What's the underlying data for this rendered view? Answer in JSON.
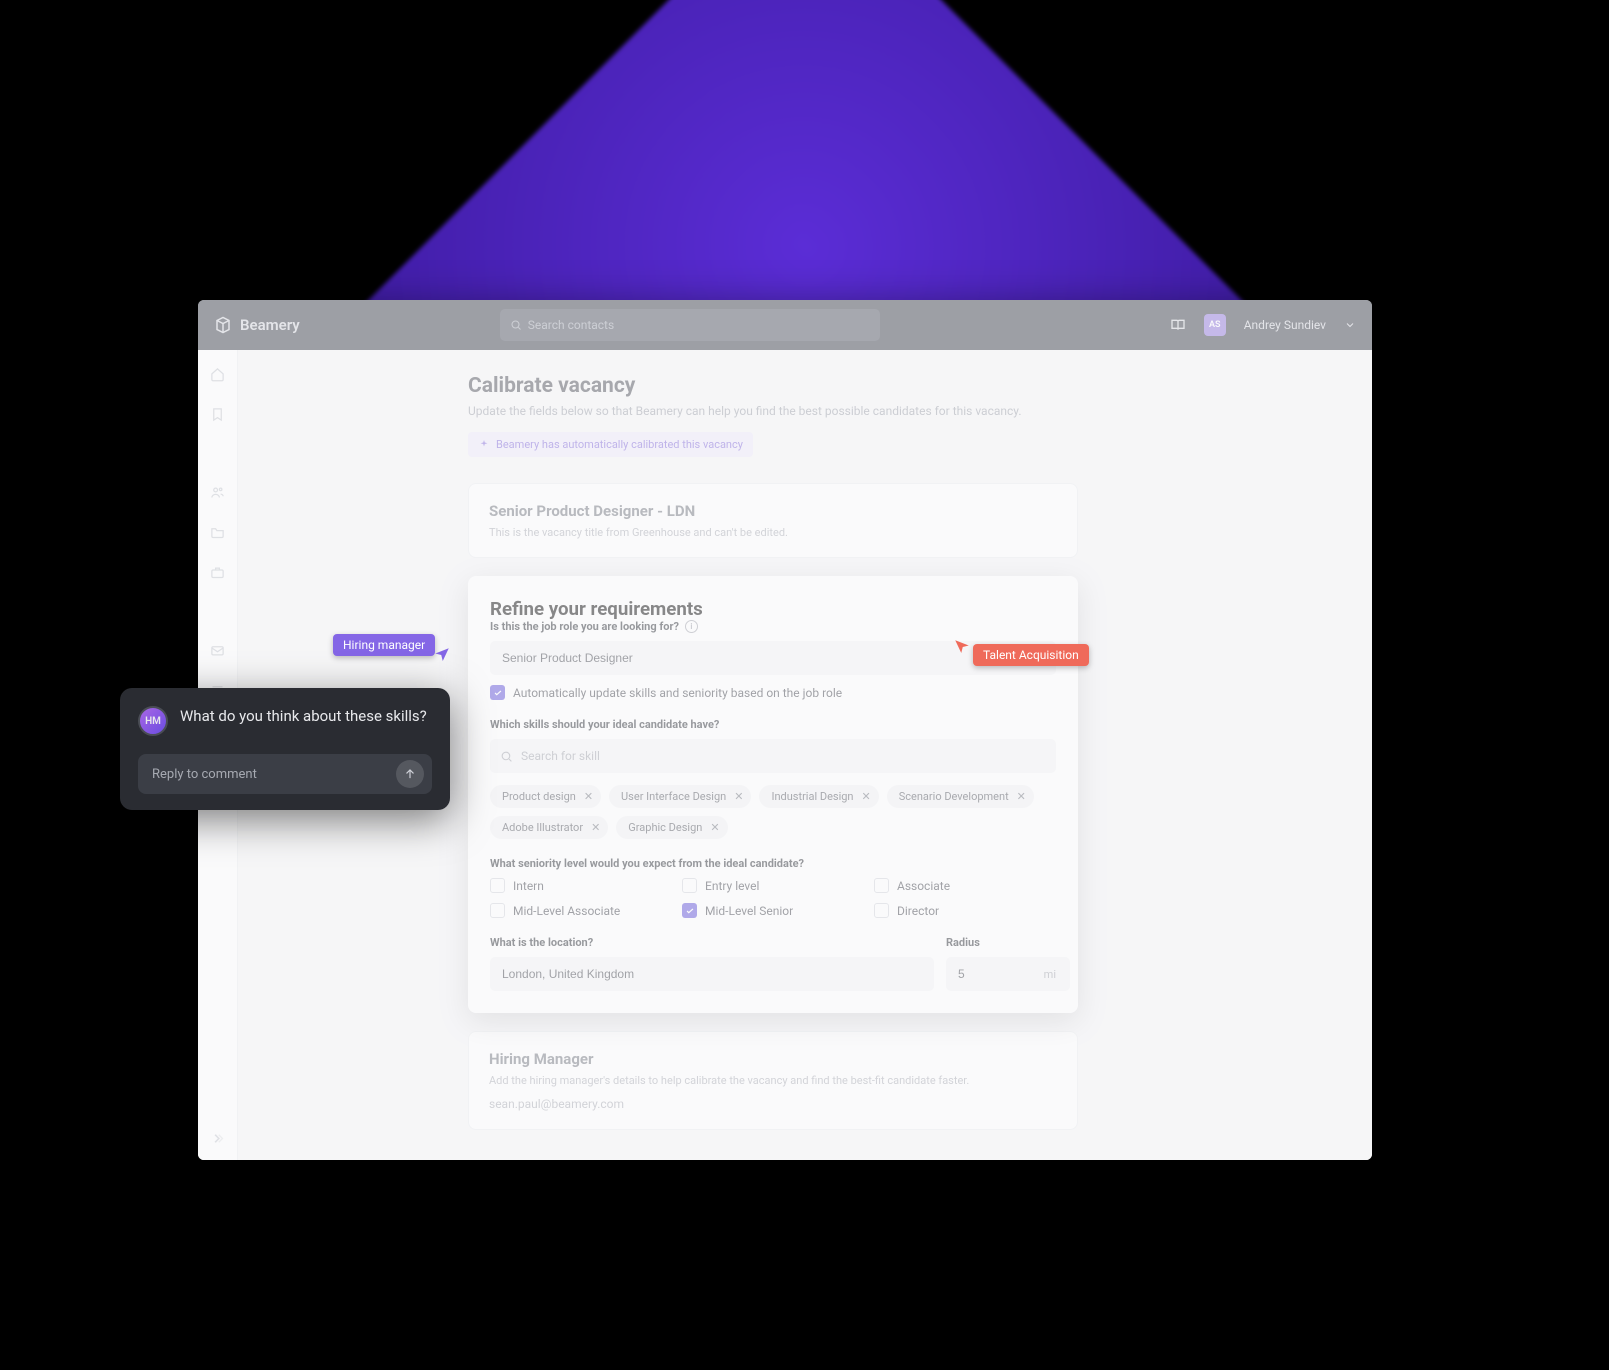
{
  "brand": {
    "name": "Beamery"
  },
  "search": {
    "placeholder": "Search contacts"
  },
  "user": {
    "initials": "AS",
    "name": "Andrey Sundiev"
  },
  "page": {
    "title": "Calibrate vacancy",
    "subtitle": "Update the fields below so that Beamery can help you find the best possible candidates for this vacancy.",
    "auto_badge": "Beamery has automatically calibrated this vacancy"
  },
  "title_block": {
    "heading": "Senior Product Designer - LDN",
    "sub": "This is the vacancy title from Greenhouse and can't be edited."
  },
  "refine": {
    "heading": "Refine your requirements",
    "role_label": "Is this the job role you are looking for?",
    "role_value": "Senior Product Designer",
    "auto_update_label": "Automatically update skills and seniority based on the job role",
    "auto_update_checked": true,
    "skills_label": "Which skills should your ideal candidate have?",
    "skills_placeholder": "Search for skill",
    "skills": [
      "Product design",
      "User Interface Design",
      "Industrial Design",
      "Scenario Development",
      "Adobe Illustrator",
      "Graphic Design"
    ],
    "seniority_label": "What seniority level would you expect from the ideal candidate?",
    "seniority": [
      {
        "label": "Intern",
        "checked": false
      },
      {
        "label": "Entry level",
        "checked": false
      },
      {
        "label": "Associate",
        "checked": false
      },
      {
        "label": "Mid-Level Associate",
        "checked": false
      },
      {
        "label": "Mid-Level Senior",
        "checked": true
      },
      {
        "label": "Director",
        "checked": false
      }
    ],
    "location_label": "What is the location?",
    "location_value": "London, United Kingdom",
    "radius_label": "Radius",
    "radius_value": "5",
    "radius_unit": "mi"
  },
  "hiring_manager": {
    "heading": "Hiring Manager",
    "sub": "Add the hiring manager's details to help calibrate the vacancy and find the best-fit candidate faster.",
    "email": "sean.paul@beamery.com"
  },
  "cursors": {
    "hm": "Hiring manager",
    "ta": "Talent Acquisition"
  },
  "comment": {
    "avatar": "HM",
    "text": "What do you think about these skills?",
    "reply_placeholder": "Reply to comment"
  }
}
